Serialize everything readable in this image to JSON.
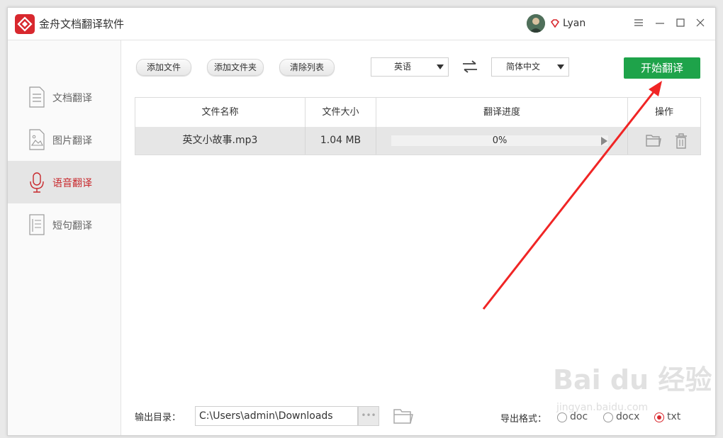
{
  "app": {
    "title": "金舟文档翻译软件",
    "user": "Lyan"
  },
  "sidebar": {
    "items": [
      {
        "label": "文档翻译",
        "icon": "document-icon",
        "active": false
      },
      {
        "label": "图片翻译",
        "icon": "image-icon",
        "active": false
      },
      {
        "label": "语音翻译",
        "icon": "microphone-icon",
        "active": true
      },
      {
        "label": "短句翻译",
        "icon": "text-file-icon",
        "active": false
      }
    ]
  },
  "toolbar": {
    "add_file": "添加文件",
    "add_folder": "添加文件夹",
    "clear_list": "清除列表",
    "source_lang": "英语",
    "target_lang": "简体中文",
    "start": "开始翻译"
  },
  "table": {
    "headers": [
      "文件名称",
      "文件大小",
      "翻译进度",
      "操作"
    ],
    "rows": [
      {
        "name": "英文小故事.mp3",
        "size": "1.04 MB",
        "progress": "0%"
      }
    ]
  },
  "output": {
    "label": "输出目录：",
    "path": "C:\\Users\\admin\\Downloads",
    "more": "•••",
    "format_label": "导出格式：",
    "formats": [
      "doc",
      "docx",
      "txt"
    ],
    "selected_format": "txt"
  },
  "watermark": {
    "main": "Bai du 经验",
    "sub": "jingyan.baidu.com"
  },
  "colors": {
    "accent": "#d8282e",
    "start_button": "#1ea34a",
    "annotation_arrow": "#f02525"
  }
}
